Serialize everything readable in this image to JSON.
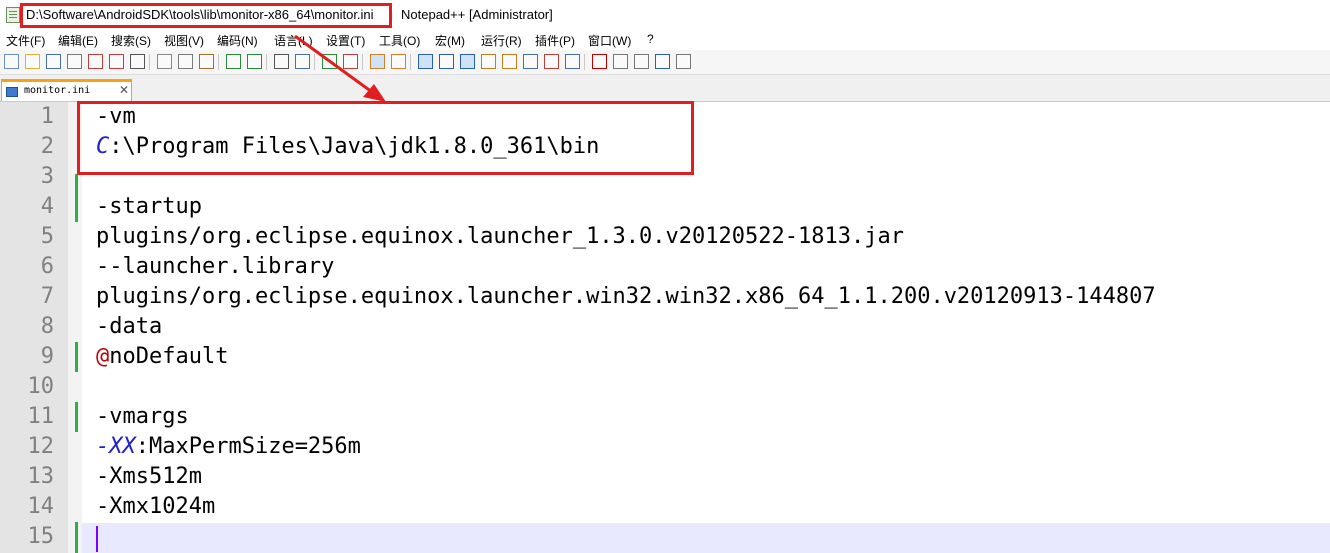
{
  "window": {
    "file_path": "D:\\Software\\AndroidSDK\\tools\\lib\\monitor-x86_64\\monitor.ini",
    "app_title": "Notepad++ [Administrator]"
  },
  "menu": [
    "文件(F)",
    "编辑(E)",
    "搜索(S)",
    "视图(V)",
    "编码(N)",
    "语言(L)",
    "设置(T)",
    "工具(O)",
    "宏(M)",
    "运行(R)",
    "插件(P)",
    "窗口(W)",
    "?"
  ],
  "tab": {
    "label": "monitor.ini",
    "close": "✕"
  },
  "lines": [
    {
      "no": "1",
      "text": "-vm"
    },
    {
      "no": "2",
      "prefix": "C",
      "prefix_style": "blue",
      "text": ":\\Program Files\\Java\\jdk1.8.0_361\\bin"
    },
    {
      "no": "3",
      "text": ""
    },
    {
      "no": "4",
      "text": "-startup"
    },
    {
      "no": "5",
      "text": "plugins/org.eclipse.equinox.launcher_1.3.0.v20120522-1813.jar"
    },
    {
      "no": "6",
      "text": "--launcher.library"
    },
    {
      "no": "7",
      "text": "plugins/org.eclipse.equinox.launcher.win32.win32.x86_64_1.1.200.v20120913-144807"
    },
    {
      "no": "8",
      "text": "-data"
    },
    {
      "no": "9",
      "prefix": "@",
      "prefix_style": "red",
      "text": "noDefault"
    },
    {
      "no": "10",
      "text": ""
    },
    {
      "no": "11",
      "text": "-vmargs"
    },
    {
      "no": "12",
      "prefix": "-XX",
      "prefix_style": "blue",
      "text": ":MaxPermSize=256m"
    },
    {
      "no": "13",
      "text": "-Xms512m"
    },
    {
      "no": "14",
      "text": "-Xmx1024m"
    },
    {
      "no": "15",
      "text": ""
    }
  ],
  "colors": {
    "highlight": "#e02020",
    "change_bar": "#2fae45",
    "current_line": "#e8e8ff"
  },
  "toolbar_icons": [
    "new-file-icon",
    "open-file-icon",
    "save-icon",
    "save-all-icon",
    "close-icon",
    "close-all-icon",
    "print-icon",
    "cut-icon",
    "copy-icon",
    "paste-icon",
    "undo-icon",
    "redo-icon",
    "find-icon",
    "replace-icon",
    "zoom-in-icon",
    "zoom-out-icon",
    "sync-v-icon",
    "sync-h-icon",
    "word-wrap-icon",
    "show-all-chars-icon",
    "indent-guide-icon",
    "udl-icon",
    "doc-map-icon",
    "function-list-icon",
    "folder-workspace-icon",
    "monitor-icon",
    "record-macro-icon",
    "stop-macro-icon",
    "play-macro-icon",
    "run-macro-multiple-icon",
    "save-macro-icon"
  ]
}
